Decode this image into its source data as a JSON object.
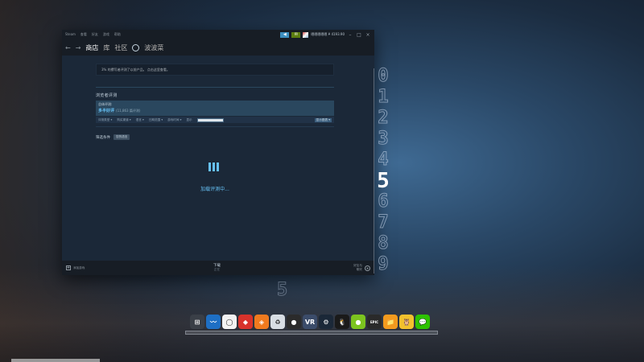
{
  "window": {
    "menu": [
      "Steam",
      "查看",
      "好友",
      "游戏",
      "帮助"
    ],
    "user_label": "嗯嗯嗯嗯嗯 ¥ 4193.90",
    "controls": {
      "min": "–",
      "max": "□",
      "close": "×"
    }
  },
  "nav": {
    "back": "←",
    "forward": "→",
    "items": [
      "商店",
      "库",
      "社区",
      "波波菜"
    ]
  },
  "info_text": "3% 的撰写者评测了以前产品。 点击这里查看。",
  "reviews": {
    "section_title": "浏览者评测",
    "summary_label": "总体评测:",
    "summary_score": "多半好评",
    "summary_count": "(11,863 篇评测)",
    "filters": [
      "评测类型 ▾",
      "购买渠道 ▾",
      "语言 ▾",
      "日期范围 ▾",
      "游戏时间 ▾",
      "显示"
    ],
    "filter_button": "显示图表 ▾"
  },
  "conditions": {
    "label": "筛选条件",
    "chip": "您的语言"
  },
  "loading_text": "加载评测中...",
  "footer": {
    "left_text": "添加游戏",
    "center_title": "下载",
    "center_sub": "正在",
    "right_line1": "好友与",
    "right_line2": "聊天"
  },
  "digits": [
    "0",
    "1",
    "2",
    "3",
    "4",
    "5",
    "6",
    "7",
    "8",
    "9"
  ],
  "active_digit": "5",
  "ghost_digit": "5",
  "dock": [
    {
      "name": "start-icon",
      "glyph": "⊞",
      "bg": "#3a3f47"
    },
    {
      "name": "network-monitor-icon",
      "glyph": "〰",
      "bg": "#1e6fc4"
    },
    {
      "name": "oculus-icon",
      "glyph": "◯",
      "bg": "#f2f2f2"
    },
    {
      "name": "red-app-icon",
      "glyph": "◆",
      "bg": "#d8322b"
    },
    {
      "name": "orange-diamond-icon",
      "glyph": "◈",
      "bg": "#f07a1e"
    },
    {
      "name": "recycle-bin-icon",
      "glyph": "♻",
      "bg": "#d8dde3"
    },
    {
      "name": "obs-icon",
      "glyph": "●",
      "bg": "#2b2b2b"
    },
    {
      "name": "vr-icon",
      "glyph": "VR",
      "bg": "#3b4c6a"
    },
    {
      "name": "steam-icon",
      "glyph": "⚙",
      "bg": "#1b2838"
    },
    {
      "name": "qq-icon",
      "glyph": "🐧",
      "bg": "#1a1a1a"
    },
    {
      "name": "green-ball-icon",
      "glyph": "●",
      "bg": "#7cc41f"
    },
    {
      "name": "epic-games-icon",
      "glyph": "EPIC",
      "bg": "#2a2a2a"
    },
    {
      "name": "orange-folder-icon",
      "glyph": "📁",
      "bg": "#f39a1e"
    },
    {
      "name": "owl-icon",
      "glyph": "🦉",
      "bg": "#f2c12e"
    },
    {
      "name": "wechat-icon",
      "glyph": "💬",
      "bg": "#2dc100"
    }
  ],
  "colors": {
    "steam_blue": "#66c0f4",
    "steam_bg": "#1b2838",
    "steam_dark": "#171d25"
  }
}
